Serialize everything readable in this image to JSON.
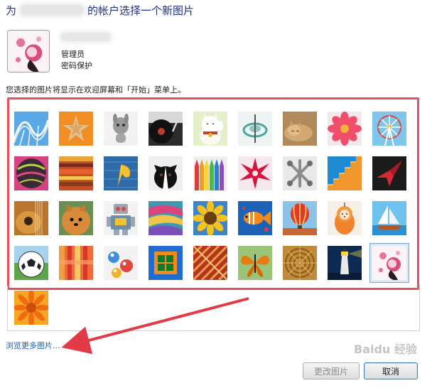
{
  "title": {
    "prefix": "为",
    "suffix": "的帐户选择一个新图片"
  },
  "account": {
    "role": "管理员",
    "protection": "密码保护"
  },
  "hint": "您选择的图片将显示在欢迎屏幕和「开始」菜单上。",
  "pictures": [
    "roller-coaster",
    "starfish",
    "robot-toy",
    "record-player",
    "lucky-cat",
    "spinning-top",
    "sleeping-kitten",
    "pink-flower",
    "ferris-wheel",
    "striped-ball",
    "colorful-fabric",
    "ginkgo-leaf",
    "border-collie",
    "crayons",
    "red-star-ornament",
    "metal-jacks",
    "stairs",
    "paper-crane",
    "guitar",
    "pomeranian",
    "tin-robot",
    "scarves",
    "sunflower",
    "tropical-fish",
    "hot-air-balloon",
    "matryoshka-doll",
    "sailboat",
    "soccer-ball",
    "striped-cloth",
    "marbles",
    "window",
    "woven-fabric",
    "butterfly",
    "wicker-pattern",
    "lighthouse",
    "floral-girl",
    "orange-daisy"
  ],
  "selected_picture": "floral-girl",
  "browse_link": "浏览更多图片...",
  "buttons": {
    "change": "更改图片",
    "cancel": "取消"
  },
  "watermark": "Baidu 经验"
}
